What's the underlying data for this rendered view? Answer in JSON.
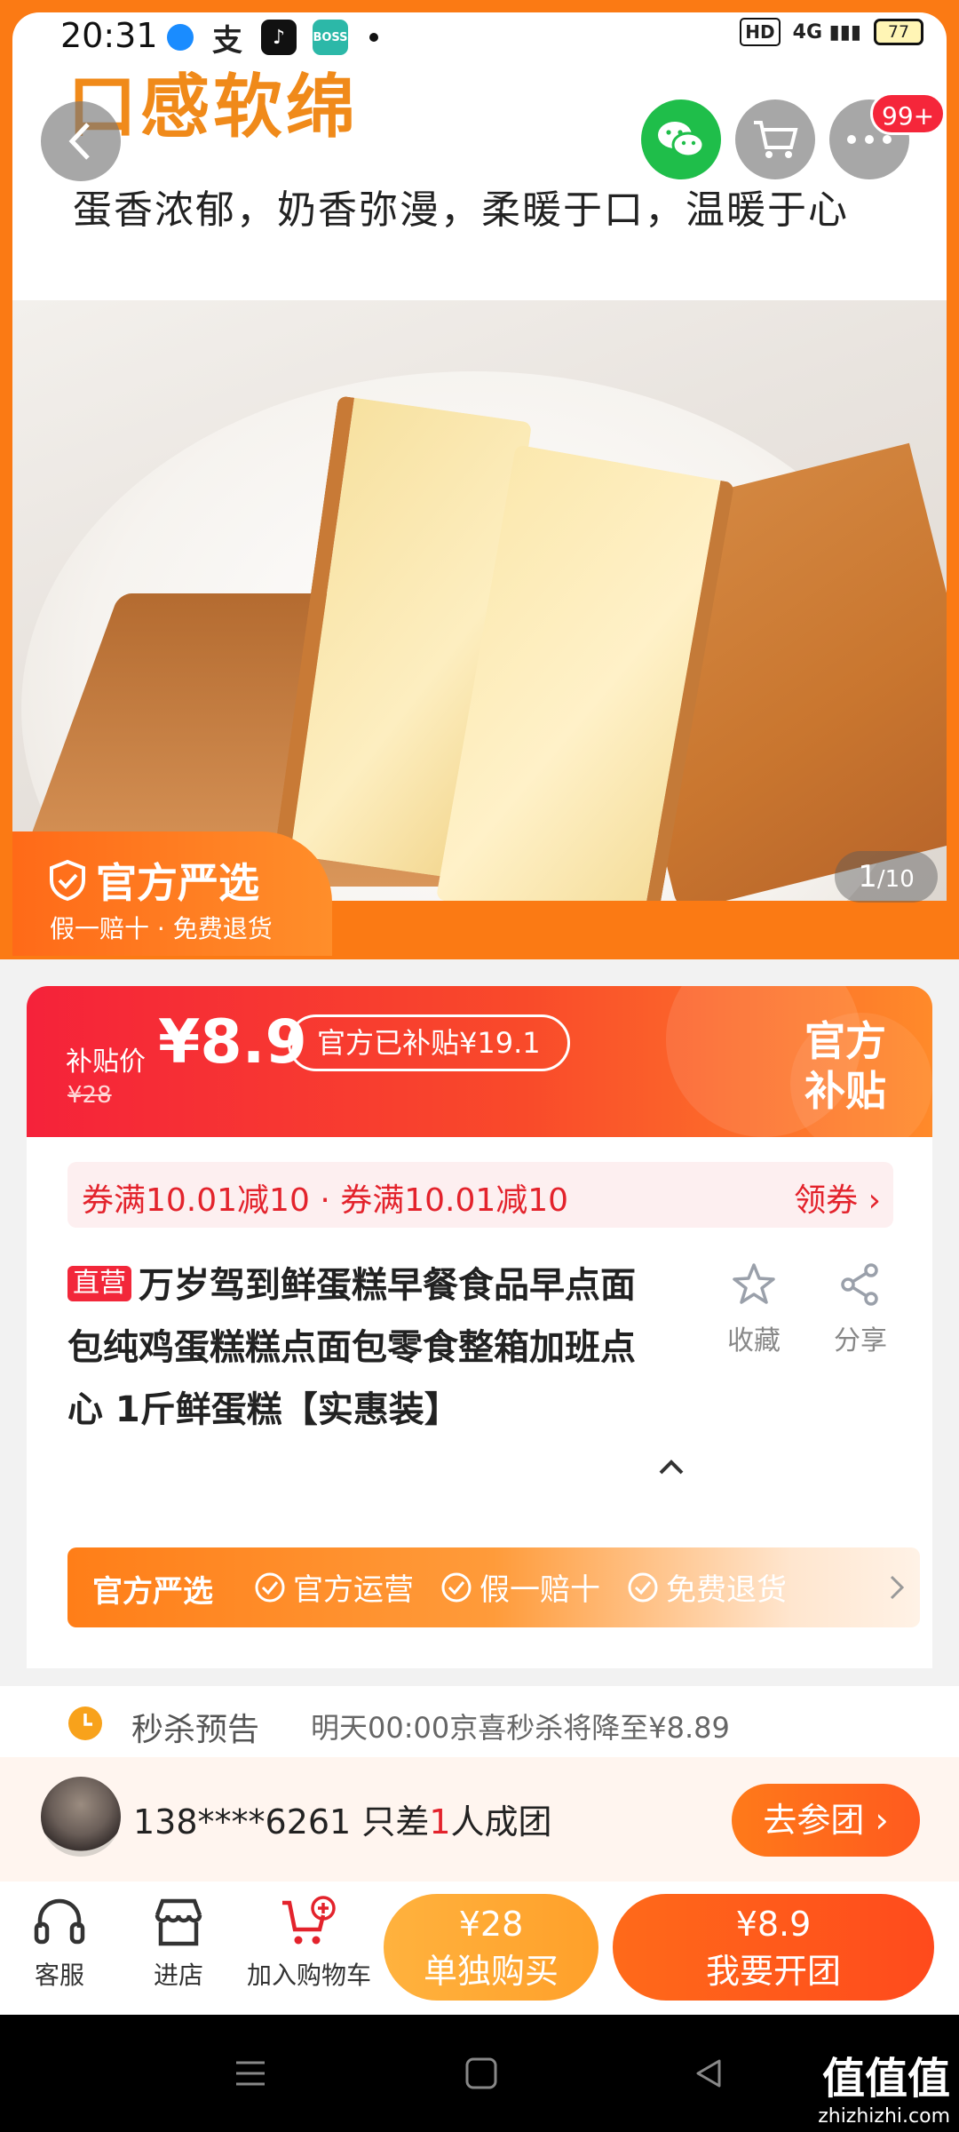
{
  "statusbar": {
    "time": "20:31",
    "apps": [
      {
        "icon": "blue-dot-app-icon",
        "text": "",
        "color": "#1a8cff"
      },
      {
        "icon": "alipay-icon",
        "text": "支",
        "color": "#222222"
      },
      {
        "icon": "tiktok-icon",
        "text": "♪",
        "color": "#111111"
      },
      {
        "icon": "boss-zhipin-icon",
        "text": "BOSS",
        "color": "#2cb8a8"
      }
    ],
    "hd": "HD",
    "signal": "4G",
    "battery": "77"
  },
  "hero": {
    "headline": "口感软绵",
    "subline": "蛋香浓郁，奶香弥漫，柔暖于口，温暖于心",
    "badge_title": "官方严选",
    "badge_sub": "假一赔十 · 免费退货",
    "pager_current": "1",
    "pager_total": "/10",
    "msg_badge": "99+"
  },
  "price": {
    "label": "补贴价",
    "value": "¥8.9",
    "original": "¥28",
    "subsidy": "官方已补贴¥19.1",
    "official_line1": "官方",
    "official_line2": "补贴"
  },
  "coupon": {
    "text": "券满10.01减10 · 券满10.01减10",
    "action": "领券 ›"
  },
  "product": {
    "tag": "直营",
    "title": "万岁驾到鲜蛋糕早餐食品早点面包纯鸡蛋糕糕点面包零食整箱加班点心 1斤鲜蛋糕【实惠装】",
    "favorite_label": "收藏",
    "share_label": "分享"
  },
  "yanxuan": {
    "title": "官方严选",
    "features": [
      "官方运营",
      "假一赔十",
      "免费退货"
    ]
  },
  "flash": {
    "label": "秒杀预告",
    "text": "明天00:00京喜秒杀将降至¥8.89"
  },
  "group": {
    "user": "138****6261",
    "prefix": " 只差",
    "count": "1",
    "suffix": "人成团",
    "join": "去参团 ›"
  },
  "bottom": {
    "service": "客服",
    "store": "进店",
    "cart": "加入购物车",
    "single_price": "¥28",
    "single_label": "单独购买",
    "group_price": "¥8.9",
    "group_label": "我要开团"
  },
  "watermark": {
    "big": "值值值",
    "small": "zhizhizhi.com"
  }
}
